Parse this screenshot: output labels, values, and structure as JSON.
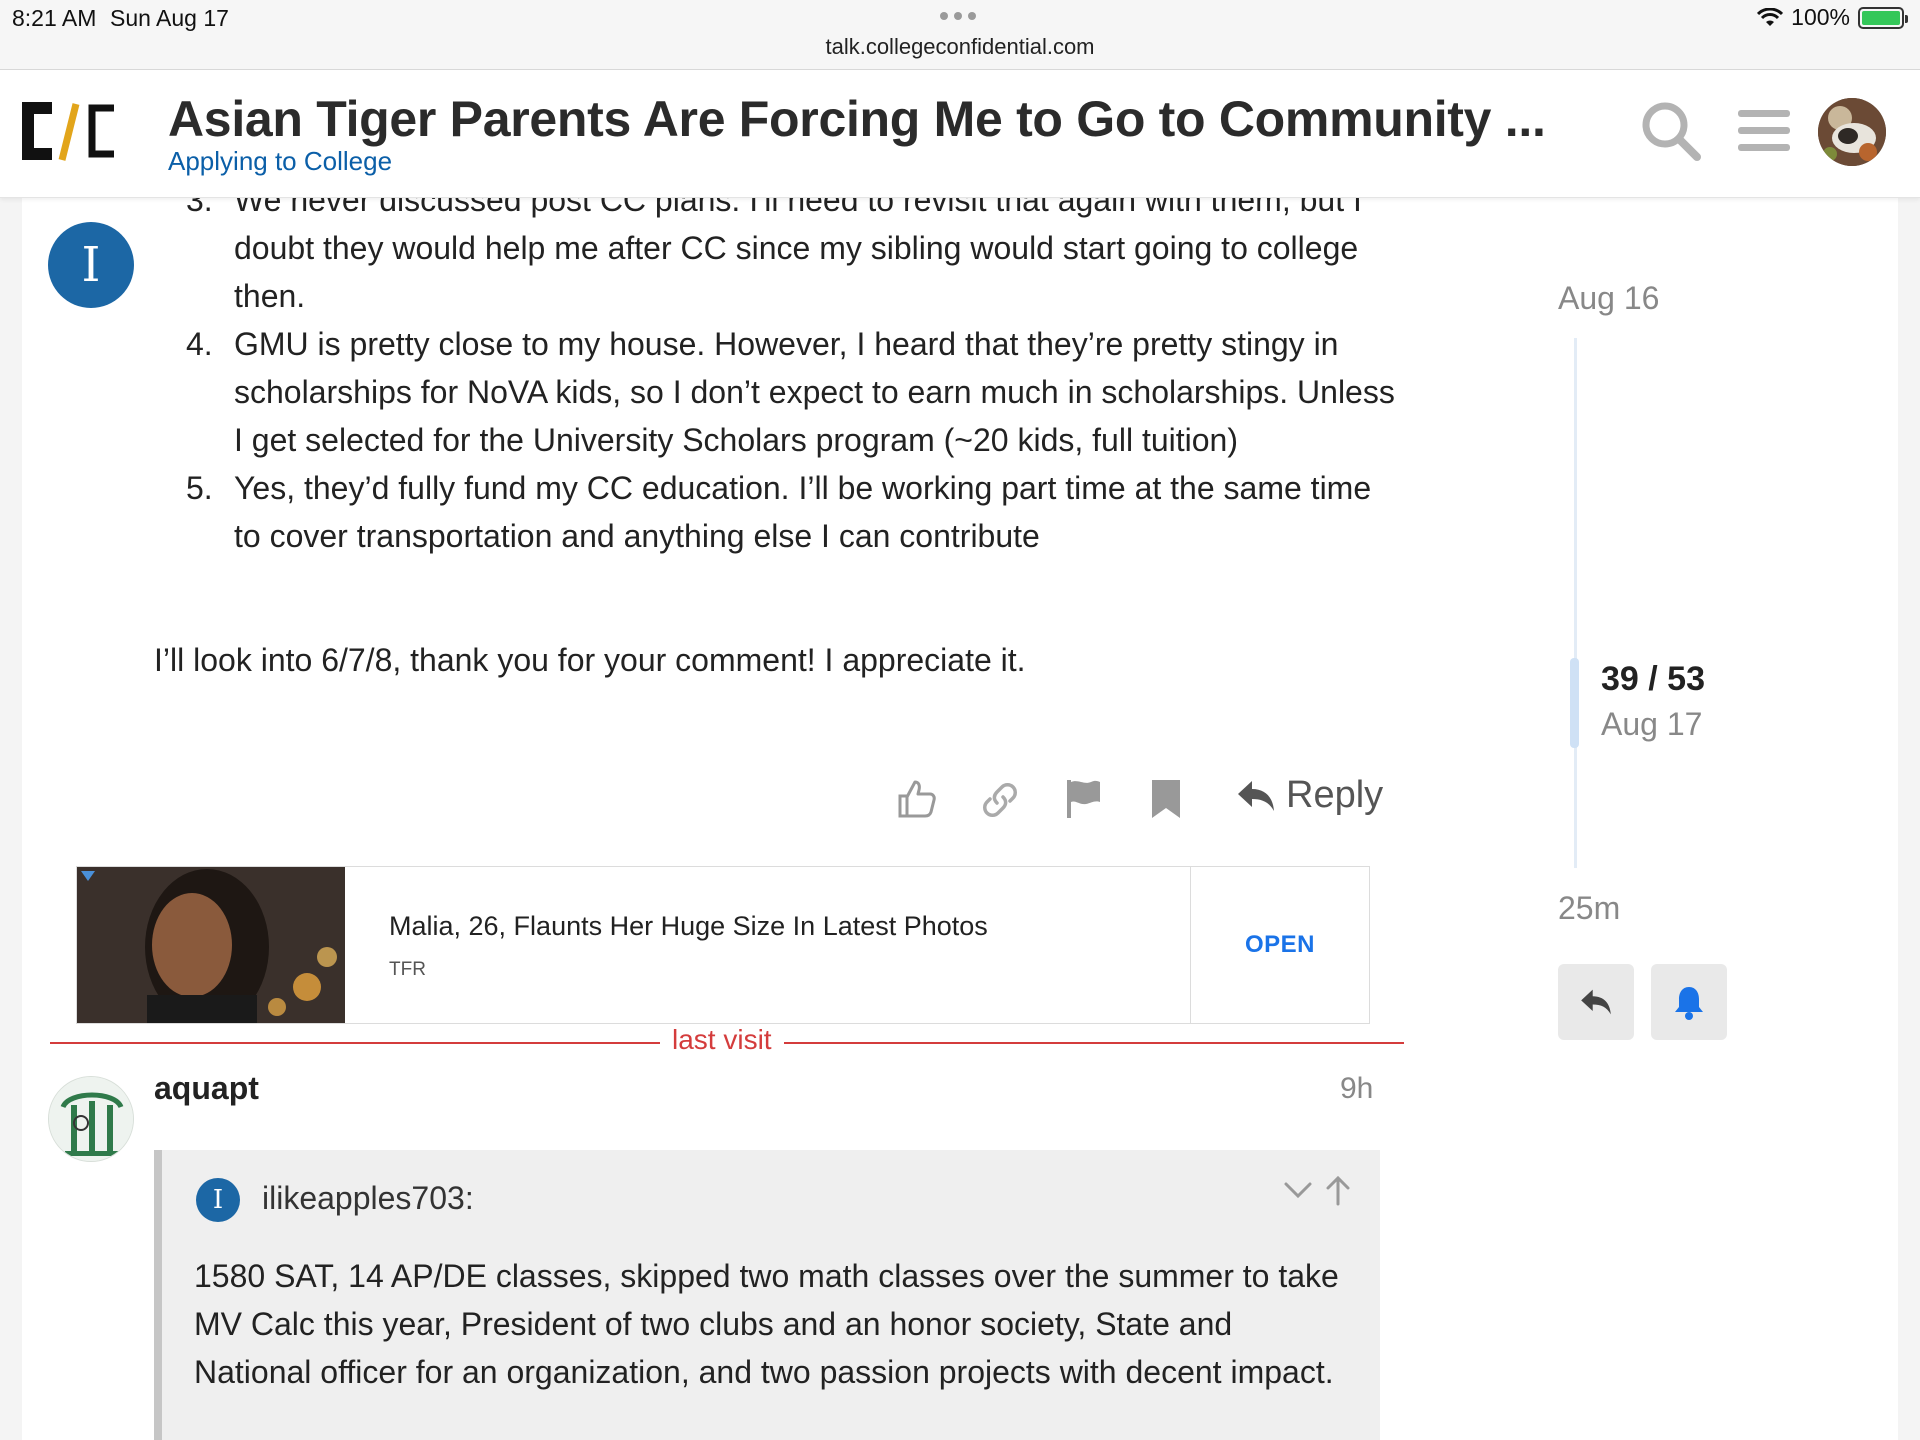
{
  "status_bar": {
    "time": "8:21 AM",
    "date": "Sun Aug 17",
    "url": "talk.collegeconfidential.com",
    "battery": "100%"
  },
  "header": {
    "title": "Asian Tiger Parents Are Forcing Me to Go to Community ...",
    "category": "Applying to College",
    "category_color": "#0b5fa8",
    "logo_icon": "cc-logo",
    "search_icon": "search-icon",
    "menu_icon": "hamburger-menu-icon"
  },
  "post1": {
    "avatar_letter": "I",
    "avatar_color": "#1c67a5",
    "list": [
      {
        "num": "3.",
        "text": "We never discussed post CC plans. I'll need to revisit that again with them, but I doubt they would help me after CC since my sibling would start going to college then."
      },
      {
        "num": "4.",
        "text": "GMU is pretty close to my house. However, I heard that they’re pretty stingy in scholarships for NoVA kids, so I don’t expect to earn much in scholarships. Unless I get selected for the University Scholars program (~20 kids, full tuition)"
      },
      {
        "num": "5.",
        "text": "Yes, they’d fully fund my CC education. I’ll be working part time at the same time to cover transportation and anything else I can contribute"
      }
    ],
    "closing": "I’ll look into 6/7/8, thank you for your comment! I appreciate it.",
    "reply_label": "Reply"
  },
  "ad": {
    "title": "Malia, 26, Flaunts Her Huge Size In Latest Photos",
    "source": "TFR",
    "cta": "OPEN"
  },
  "last_visit": "last visit",
  "post2": {
    "username": "aquapt",
    "time": "9h",
    "quote": {
      "avatar_letter": "I",
      "username": "ilikeapples703:",
      "text": "1580 SAT, 14 AP/DE classes, skipped two math classes over the summer to take MV Calc this year, President of two clubs and an honor society, State and National officer for an organization, and two passion projects with decent impact."
    }
  },
  "timeline": {
    "start_date": "Aug 16",
    "position": "39 / 53",
    "current_date": "Aug 17",
    "end_label": "25m",
    "current_post": 39,
    "total_posts": 53
  }
}
